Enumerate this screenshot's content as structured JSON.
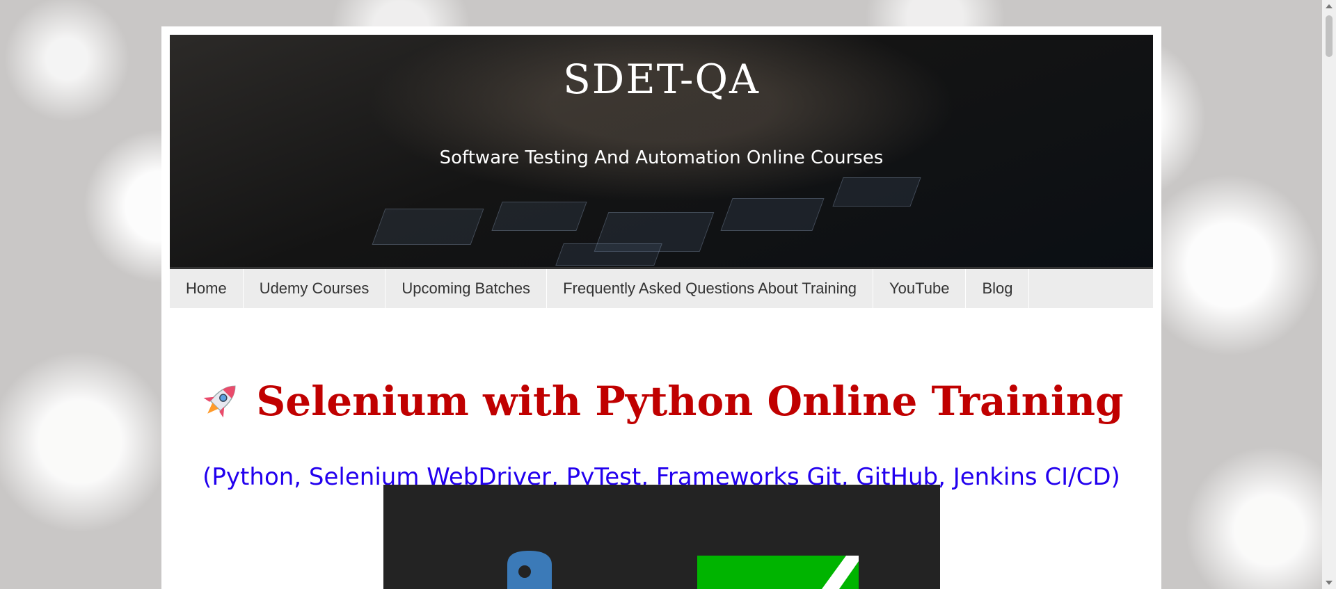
{
  "header": {
    "site_title": "SDET-QA",
    "tagline": "Software Testing And Automation Online Courses"
  },
  "nav": {
    "items": [
      {
        "label": "Home"
      },
      {
        "label": "Udemy Courses"
      },
      {
        "label": "Upcoming Batches"
      },
      {
        "label": "Frequently Asked Questions About Training"
      },
      {
        "label": "YouTube"
      },
      {
        "label": "Blog"
      }
    ]
  },
  "main": {
    "headline": "Selenium with Python Online Training",
    "headline_icon": "rocket-icon",
    "subheadline": "(Python, Selenium WebDriver, PyTest, Frameworks Git, GitHub, Jenkins CI/CD)"
  },
  "colors": {
    "headline": "#c00000",
    "subheadline": "#2200ee",
    "nav_background": "#ececec",
    "banner_background": "#232323"
  }
}
